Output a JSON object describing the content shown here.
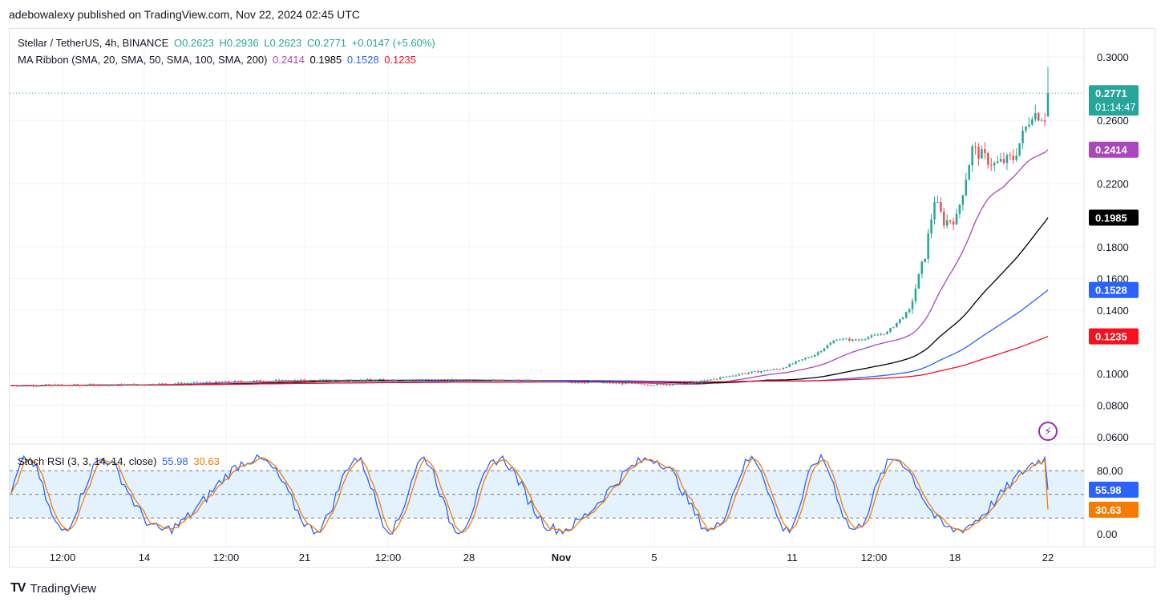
{
  "header": {
    "publisher": "adebowalexy published on TradingView.com, Nov 22, 2024 02:45 UTC"
  },
  "legend": {
    "symbol": "Stellar / TetherUS, 4h, BINANCE",
    "open": "O0.2623",
    "high": "H0.2936",
    "low": "L0.2623",
    "close": "C0.2771",
    "change": "+0.0147 (+5.60%)",
    "ma_title": "MA Ribbon (SMA, 20, SMA, 50, SMA, 100, SMA, 200)",
    "ma20": "0.2414",
    "ma50": "0.1985",
    "ma100": "0.1528",
    "ma200": "0.1235",
    "stoch_title": "Stoch RSI (3, 3, 14, 14, close)",
    "stoch_k": "55.98",
    "stoch_d": "30.63"
  },
  "price_labels": {
    "last": "0.2771",
    "countdown": "01:14:47",
    "ma20": "0.2414",
    "ma50": "0.1985",
    "ma100": "0.1528",
    "ma200": "0.1235",
    "stoch_k": "55.98",
    "stoch_d": "30.63"
  },
  "colors": {
    "up": "#26a69a",
    "down": "#ef5350",
    "ma20": "#ab47bc",
    "ma50": "#000000",
    "ma100": "#2962ff",
    "ma200": "#f7101d",
    "stoch_k": "#2962ff",
    "stoch_d": "#f57c00",
    "stoch_band": "#e3f2fd"
  },
  "footer": {
    "brand": "TradingView"
  },
  "chart_data": [
    {
      "type": "candlestick",
      "title": "Stellar / TetherUS, 4h, BINANCE",
      "yticks": [
        "0.3000",
        "0.2600",
        "0.2200",
        "0.1800",
        "0.1600",
        "0.1400",
        "0.1000",
        "0.0800",
        "0.0600"
      ],
      "ylim": [
        0.055,
        0.31
      ],
      "xticks": [
        "12:00",
        "14",
        "12:00",
        "21",
        "12:00",
        "28",
        "Nov",
        "5",
        "11",
        "12:00",
        "18",
        "22"
      ],
      "last_close": 0.2771,
      "series": [
        {
          "name": "MA20",
          "last": 0.2414
        },
        {
          "name": "MA50",
          "last": 0.1985
        },
        {
          "name": "MA100",
          "last": 0.1528
        },
        {
          "name": "MA200",
          "last": 0.1235
        }
      ]
    },
    {
      "type": "line",
      "title": "Stoch RSI (3, 3, 14, 14, close)",
      "yticks": [
        "80.00",
        "0.00"
      ],
      "ylim": [
        -10,
        100
      ],
      "bands": [
        20,
        50,
        80
      ],
      "series": [
        {
          "name": "K",
          "last": 55.98
        },
        {
          "name": "D",
          "last": 30.63
        }
      ]
    }
  ]
}
